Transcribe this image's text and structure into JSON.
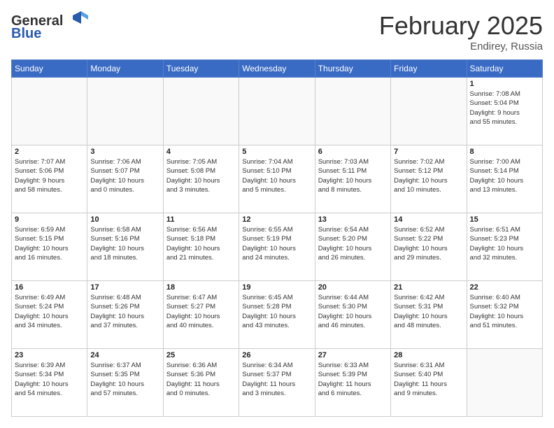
{
  "logo": {
    "general": "General",
    "blue": "Blue"
  },
  "title": "February 2025",
  "location": "Endirey, Russia",
  "days": [
    "Sunday",
    "Monday",
    "Tuesday",
    "Wednesday",
    "Thursday",
    "Friday",
    "Saturday"
  ],
  "weeks": [
    [
      {
        "day": "",
        "text": ""
      },
      {
        "day": "",
        "text": ""
      },
      {
        "day": "",
        "text": ""
      },
      {
        "day": "",
        "text": ""
      },
      {
        "day": "",
        "text": ""
      },
      {
        "day": "",
        "text": ""
      },
      {
        "day": "1",
        "text": "Sunrise: 7:08 AM\nSunset: 5:04 PM\nDaylight: 9 hours\nand 55 minutes."
      }
    ],
    [
      {
        "day": "2",
        "text": "Sunrise: 7:07 AM\nSunset: 5:06 PM\nDaylight: 9 hours\nand 58 minutes."
      },
      {
        "day": "3",
        "text": "Sunrise: 7:06 AM\nSunset: 5:07 PM\nDaylight: 10 hours\nand 0 minutes."
      },
      {
        "day": "4",
        "text": "Sunrise: 7:05 AM\nSunset: 5:08 PM\nDaylight: 10 hours\nand 3 minutes."
      },
      {
        "day": "5",
        "text": "Sunrise: 7:04 AM\nSunset: 5:10 PM\nDaylight: 10 hours\nand 5 minutes."
      },
      {
        "day": "6",
        "text": "Sunrise: 7:03 AM\nSunset: 5:11 PM\nDaylight: 10 hours\nand 8 minutes."
      },
      {
        "day": "7",
        "text": "Sunrise: 7:02 AM\nSunset: 5:12 PM\nDaylight: 10 hours\nand 10 minutes."
      },
      {
        "day": "8",
        "text": "Sunrise: 7:00 AM\nSunset: 5:14 PM\nDaylight: 10 hours\nand 13 minutes."
      }
    ],
    [
      {
        "day": "9",
        "text": "Sunrise: 6:59 AM\nSunset: 5:15 PM\nDaylight: 10 hours\nand 16 minutes."
      },
      {
        "day": "10",
        "text": "Sunrise: 6:58 AM\nSunset: 5:16 PM\nDaylight: 10 hours\nand 18 minutes."
      },
      {
        "day": "11",
        "text": "Sunrise: 6:56 AM\nSunset: 5:18 PM\nDaylight: 10 hours\nand 21 minutes."
      },
      {
        "day": "12",
        "text": "Sunrise: 6:55 AM\nSunset: 5:19 PM\nDaylight: 10 hours\nand 24 minutes."
      },
      {
        "day": "13",
        "text": "Sunrise: 6:54 AM\nSunset: 5:20 PM\nDaylight: 10 hours\nand 26 minutes."
      },
      {
        "day": "14",
        "text": "Sunrise: 6:52 AM\nSunset: 5:22 PM\nDaylight: 10 hours\nand 29 minutes."
      },
      {
        "day": "15",
        "text": "Sunrise: 6:51 AM\nSunset: 5:23 PM\nDaylight: 10 hours\nand 32 minutes."
      }
    ],
    [
      {
        "day": "16",
        "text": "Sunrise: 6:49 AM\nSunset: 5:24 PM\nDaylight: 10 hours\nand 34 minutes."
      },
      {
        "day": "17",
        "text": "Sunrise: 6:48 AM\nSunset: 5:26 PM\nDaylight: 10 hours\nand 37 minutes."
      },
      {
        "day": "18",
        "text": "Sunrise: 6:47 AM\nSunset: 5:27 PM\nDaylight: 10 hours\nand 40 minutes."
      },
      {
        "day": "19",
        "text": "Sunrise: 6:45 AM\nSunset: 5:28 PM\nDaylight: 10 hours\nand 43 minutes."
      },
      {
        "day": "20",
        "text": "Sunrise: 6:44 AM\nSunset: 5:30 PM\nDaylight: 10 hours\nand 46 minutes."
      },
      {
        "day": "21",
        "text": "Sunrise: 6:42 AM\nSunset: 5:31 PM\nDaylight: 10 hours\nand 48 minutes."
      },
      {
        "day": "22",
        "text": "Sunrise: 6:40 AM\nSunset: 5:32 PM\nDaylight: 10 hours\nand 51 minutes."
      }
    ],
    [
      {
        "day": "23",
        "text": "Sunrise: 6:39 AM\nSunset: 5:34 PM\nDaylight: 10 hours\nand 54 minutes."
      },
      {
        "day": "24",
        "text": "Sunrise: 6:37 AM\nSunset: 5:35 PM\nDaylight: 10 hours\nand 57 minutes."
      },
      {
        "day": "25",
        "text": "Sunrise: 6:36 AM\nSunset: 5:36 PM\nDaylight: 11 hours\nand 0 minutes."
      },
      {
        "day": "26",
        "text": "Sunrise: 6:34 AM\nSunset: 5:37 PM\nDaylight: 11 hours\nand 3 minutes."
      },
      {
        "day": "27",
        "text": "Sunrise: 6:33 AM\nSunset: 5:39 PM\nDaylight: 11 hours\nand 6 minutes."
      },
      {
        "day": "28",
        "text": "Sunrise: 6:31 AM\nSunset: 5:40 PM\nDaylight: 11 hours\nand 9 minutes."
      },
      {
        "day": "",
        "text": ""
      }
    ]
  ]
}
